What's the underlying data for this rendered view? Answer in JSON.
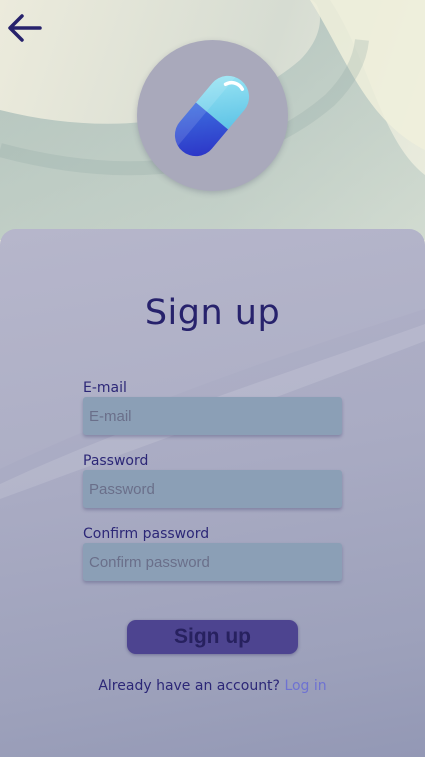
{
  "header": {
    "back_icon": "arrow-left-icon",
    "logo_icon": "capsule-icon"
  },
  "form": {
    "title": "Sign up",
    "fields": [
      {
        "label": "E-mail",
        "placeholder": "E-mail",
        "value": ""
      },
      {
        "label": "Password",
        "placeholder": "Password",
        "value": ""
      },
      {
        "label": "Confirm password",
        "placeholder": "Confirm password",
        "value": ""
      }
    ],
    "submit_label": "Sign up"
  },
  "footer": {
    "prompt": "Already have an account?",
    "link_label": "Log in"
  },
  "colors": {
    "accent": "#27226c",
    "button": "#4d4490",
    "input_bg": "#8b9fb6",
    "link": "#6e72d2"
  }
}
